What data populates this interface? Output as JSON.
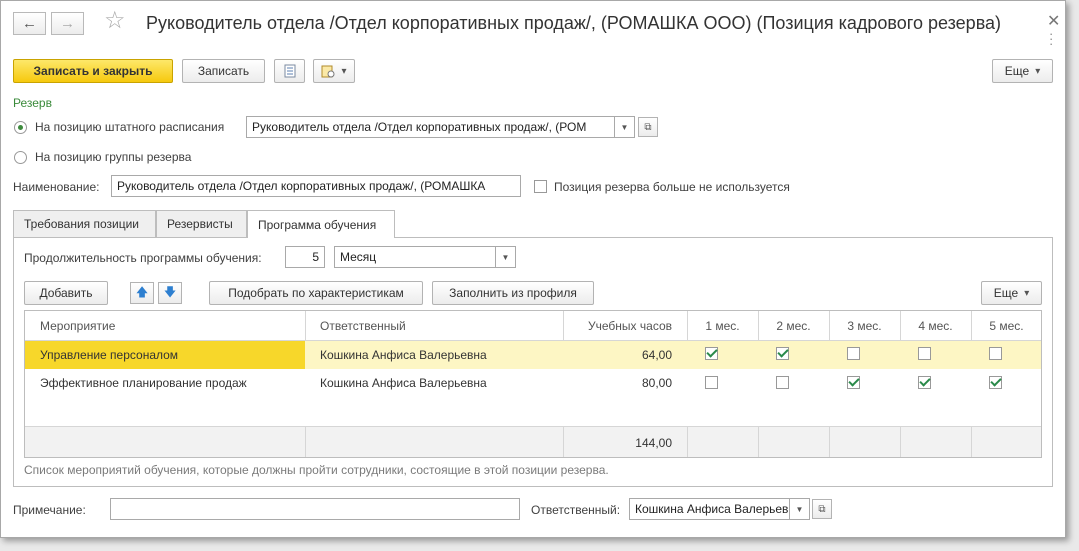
{
  "window": {
    "title": "Руководитель отдела /Отдел корпоративных продаж/, (РОМАШКА ООО) (Позиция кадрового резерва)"
  },
  "toolbar": {
    "save_close": "Записать и закрыть",
    "save": "Записать",
    "more": "Еще"
  },
  "reserve": {
    "section_label": "Резерв",
    "option_staff_label": "На позицию штатного расписания",
    "option_staff_value": "Руководитель отдела /Отдел корпоративных продаж/, (РОМ",
    "option_group_label": "На позицию группы резерва",
    "selected_option": "staff"
  },
  "name": {
    "label": "Наименование:",
    "value": "Руководитель отдела /Отдел корпоративных продаж/, (РОМАШКА",
    "unused_label": "Позиция резерва больше не используется",
    "unused_checked": false
  },
  "tabs": [
    {
      "label": "Требования позиции",
      "active": false
    },
    {
      "label": "Резервисты",
      "active": false
    },
    {
      "label": "Программа обучения",
      "active": true
    }
  ],
  "program": {
    "duration_label": "Продолжительность программы обучения:",
    "duration_value": "5",
    "duration_unit": "Месяц",
    "add_button": "Добавить",
    "pick_button": "Подобрать по характеристикам",
    "fill_button": "Заполнить из профиля",
    "more": "Еще",
    "columns": [
      "Мероприятие",
      "Ответственный",
      "Учебных часов",
      "1 мес.",
      "2 мес.",
      "3 мес.",
      "4 мес.",
      "5 мес."
    ],
    "rows": [
      {
        "event": "Управление персоналом",
        "responsible": "Кошкина Анфиса Валерьевна",
        "hours": "64,00",
        "months": [
          true,
          true,
          false,
          false,
          false
        ],
        "selected": true
      },
      {
        "event": "Эффективное планирование продаж",
        "responsible": "Кошкина Анфиса Валерьевна",
        "hours": "80,00",
        "months": [
          false,
          false,
          true,
          true,
          true
        ],
        "selected": false
      }
    ],
    "total_hours": "144,00",
    "note": "Список мероприятий обучения, которые должны пройти сотрудники, состоящие в этой позиции резерва."
  },
  "footer": {
    "note_label": "Примечание:",
    "note_value": "",
    "responsible_label": "Ответственный:",
    "responsible_value": "Кошкина Анфиса Валерьевна"
  },
  "colors": {
    "accent_green": "#3a8a3a",
    "primary_button": "#f6c90e",
    "selected_row": "#fdf6c4",
    "selected_first_cell": "#f7d72a"
  },
  "icons": {
    "back": "arrow-left-icon",
    "forward": "arrow-right-icon",
    "favorite": "star-icon",
    "close": "close-icon",
    "report": "document-list-icon",
    "print": "print-settings-icon",
    "up": "arrow-up-icon",
    "down": "arrow-down-icon"
  }
}
